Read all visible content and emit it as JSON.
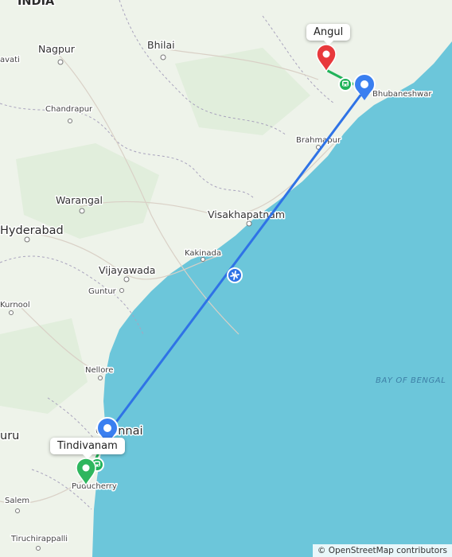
{
  "map": {
    "country_label": "INDIA",
    "cities": [
      {
        "name": "Nagpur"
      },
      {
        "name": "Bhilai"
      },
      {
        "name": "Angul"
      },
      {
        "name": "Bhubaneshwar"
      },
      {
        "name": "Chandrapur"
      },
      {
        "name": "Brahmapur"
      },
      {
        "name": "Warangal"
      },
      {
        "name": "Visakhapatnam"
      },
      {
        "name": "Hyderabad"
      },
      {
        "name": "Kakinada"
      },
      {
        "name": "Vijayawada"
      },
      {
        "name": "Guntur"
      },
      {
        "name": "Kurnool"
      },
      {
        "name": "Nellore"
      },
      {
        "name": "Chennai"
      },
      {
        "name": "Puducherry"
      },
      {
        "name": "Salem"
      },
      {
        "name": "Tiruchirappalli"
      }
    ],
    "partial_labels": {
      "left_top": "avati",
      "left_mid": "uru"
    },
    "sea_label": "BAY OF BENGAL",
    "route": {
      "origin_callout": "Tindivanam",
      "destination_callout": "Angul",
      "mode_icons": [
        "train-icon",
        "plane-icon",
        "train-icon"
      ],
      "colors": {
        "flight": "#2f73e6",
        "ground": "#21b35a",
        "origin_pin": "#2fb65e",
        "destination_pin": "#e8393c",
        "airport_pin": "#3a7ff0"
      }
    },
    "attribution": "© OpenStreetMap contributors"
  }
}
